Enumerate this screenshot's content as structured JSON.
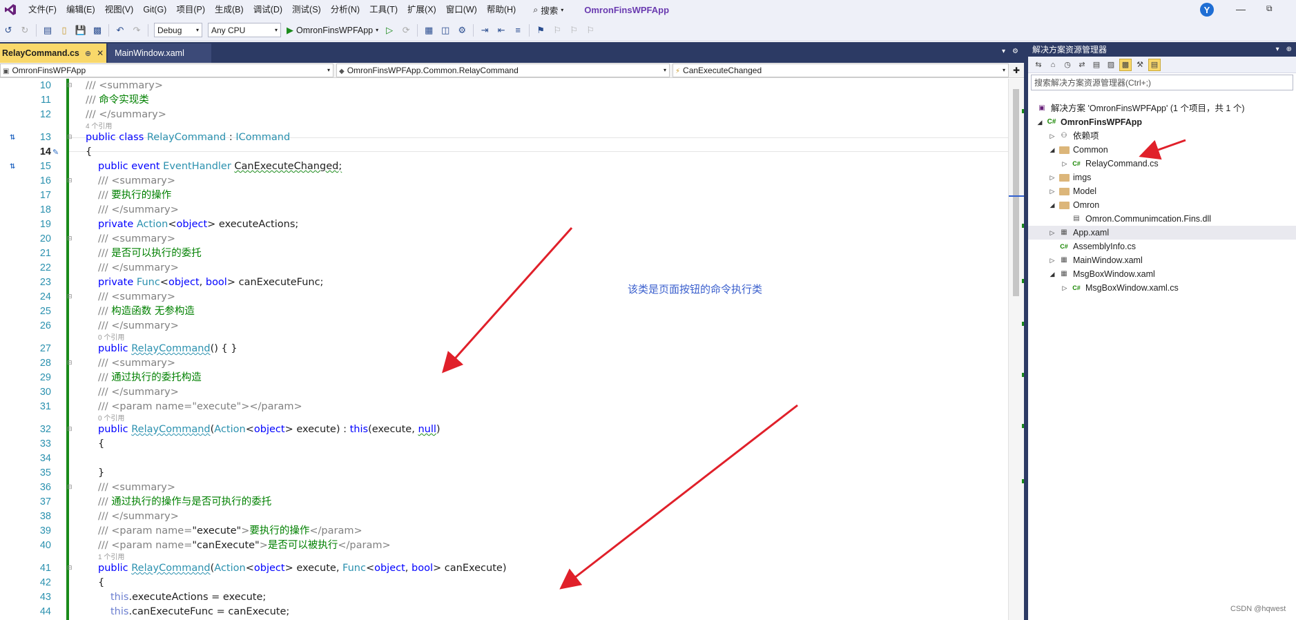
{
  "menubar": {
    "items": [
      "文件(F)",
      "编辑(E)",
      "视图(V)",
      "Git(G)",
      "项目(P)",
      "生成(B)",
      "调试(D)",
      "测试(S)",
      "分析(N)",
      "工具(T)",
      "扩展(X)",
      "窗口(W)",
      "帮助(H)"
    ],
    "search_label": "搜索",
    "app_title": "OmronFinsWPFApp",
    "avatar_letter": "Y"
  },
  "toolbar": {
    "config": "Debug",
    "platform": "Any CPU",
    "run_target": "OmronFinsWPFApp"
  },
  "tabs": {
    "active": "RelayCommand.cs",
    "inactive": "MainWindow.xaml"
  },
  "navbar": {
    "project": "OmronFinsWPFApp",
    "type": "OmronFinsWPFApp.Common.RelayCommand",
    "member": "CanExecuteChanged"
  },
  "code": {
    "ln10": "10",
    "ln11": "11",
    "ln12": "12",
    "ln13": "13",
    "ln14": "14",
    "ln15": "15",
    "ln16": "16",
    "ln17": "17",
    "ln18": "18",
    "ln19": "19",
    "ln20": "20",
    "ln21": "21",
    "ln22": "22",
    "ln23": "23",
    "ln24": "24",
    "ln25": "25",
    "ln26": "26",
    "ln27": "27",
    "ln28": "28",
    "ln29": "29",
    "ln30": "30",
    "ln31": "31",
    "ln32": "32",
    "ln33": "33",
    "ln34": "34",
    "ln35": "35",
    "ln36": "36",
    "ln37": "37",
    "ln38": "38",
    "ln39": "39",
    "ln40": "40",
    "ln41": "41",
    "ln42": "42",
    "ln43": "43",
    "ln44": "44",
    "refs4": "4 个引用",
    "refs0": "0 个引用",
    "refs1": "1 个引用",
    "summary_open": "/// <summary>",
    "summary_close": "/// </summary>",
    "c_class": "命令实现类",
    "c_exec": "要执行的操作",
    "c_can": "是否可以执行的委托",
    "c_ctor": "构造函数 无参构造",
    "c_delegate": "通过执行的委托构造",
    "c_both": "通过执行的操作与是否可执行的委托",
    "c_execute_desc": "要执行的操作",
    "c_canexec_desc": "是否可以被执行",
    "t_public": "public",
    "t_class": "class",
    "t_event": "event",
    "t_private": "private",
    "t_this": "this",
    "t_null": "null",
    "t_object": "object",
    "t_bool": "bool",
    "n_relay": "RelayCommand",
    "n_icommand": "ICommand",
    "n_eventhandler": "EventHandler",
    "n_canexecchanged": "CanExecuteChanged;",
    "n_action": "Action",
    "n_func": "Func",
    "v_execacts": "executeActions;",
    "v_canfunc": "canExecuteFunc;",
    "v_execute": "execute",
    "v_canexecute": "canExecute",
    "param_execute": "\"execute\"",
    "param_canexecute": "\"canExecute\"",
    "l43_rest": ".executeActions = execute;",
    "l44_rest": ".canExecuteFunc = canExecute;"
  },
  "annotation": "该类是页面按钮的命令执行类",
  "explorer": {
    "title": "解决方案资源管理器",
    "search_placeholder": "搜索解决方案资源管理器(Ctrl+;)",
    "solution": "解决方案 'OmronFinsWPFApp' (1 个项目，共 1 个)",
    "project": "OmronFinsWPFApp",
    "deps": "依赖项",
    "common": "Common",
    "relay_file": "RelayCommand.cs",
    "imgs": "imgs",
    "model": "Model",
    "omron": "Omron",
    "dll": "Omron.Communimcation.Fins.dll",
    "app_xaml": "App.xaml",
    "assembly": "AssemblyInfo.cs",
    "mainwindow": "MainWindow.xaml",
    "msgbox": "MsgBoxWindow.xaml",
    "msgbox_cs": "MsgBoxWindow.xaml.cs"
  },
  "watermark": "CSDN @hqwest",
  "colors": {
    "accent_purple": "#6a3bb0",
    "tab_active": "#f9d86a",
    "chrome_dark": "#2c3a64",
    "arrow_red": "#e0202a",
    "annotation_blue": "#3a5fcd"
  }
}
